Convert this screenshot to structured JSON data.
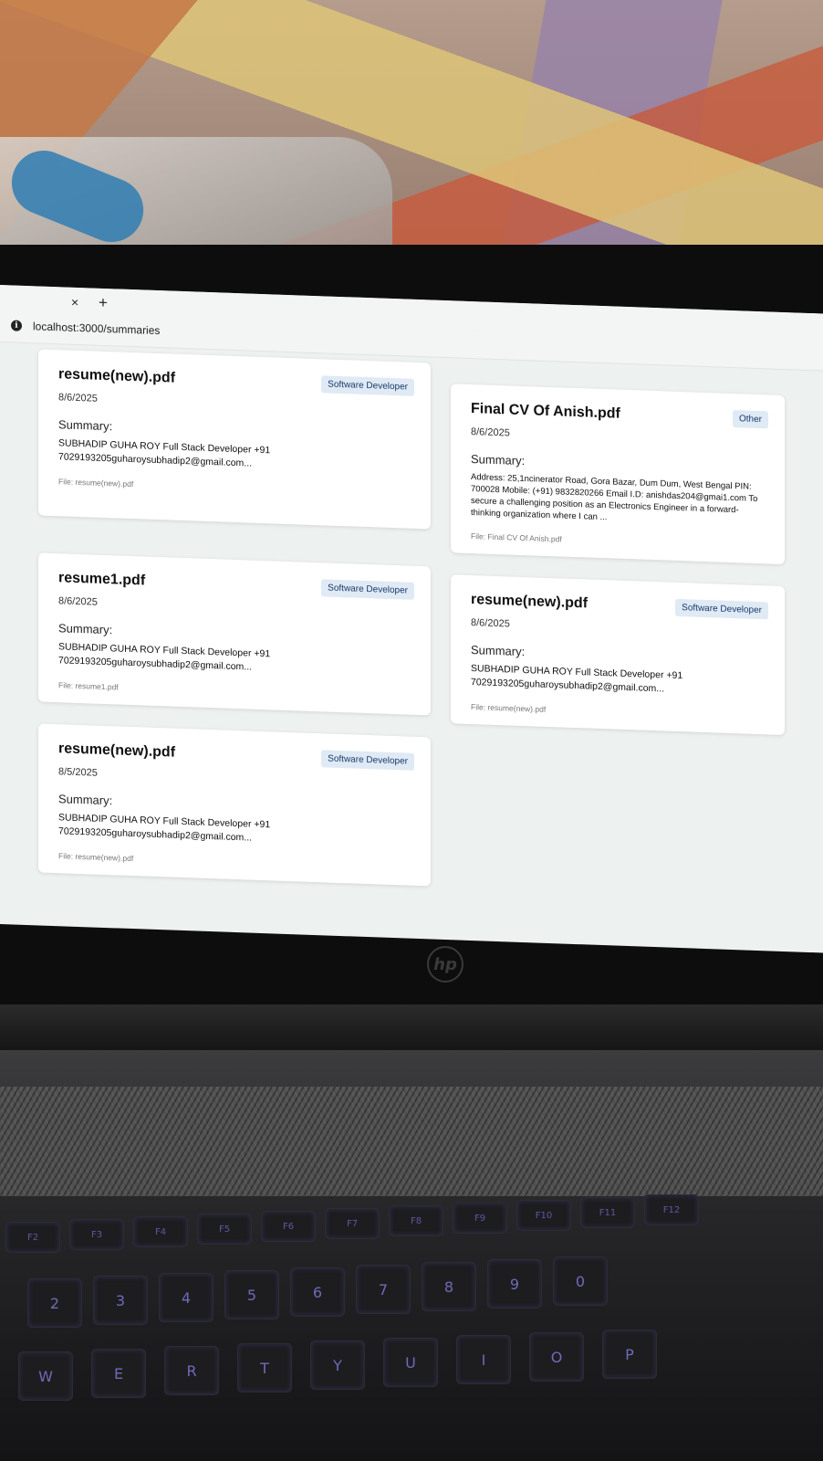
{
  "browser": {
    "url": "localhost:3000/summaries",
    "tab_close_icon": "×",
    "tab_new_icon": "+",
    "info_icon": "i"
  },
  "labels": {
    "summary": "Summary:",
    "file_prefix": "File: "
  },
  "cards": [
    {
      "title": "resume(new).pdf",
      "date": "8/6/2025",
      "badge": "Software Developer",
      "summary": "SUBHADIP GUHA ROY Full Stack Developer +91 7029193205guharoysubhadip2@gmail.com...",
      "file": "File: resume(new).pdf"
    },
    {
      "title": "Final CV Of Anish.pdf",
      "date": "8/6/2025",
      "badge": "Other",
      "summary": "Address: 25,1ncinerator Road, Gora Bazar, Dum Dum, West Bengal PIN: 700028 Mobile: (+91) 9832820266 Email I.D: anishdas204@gmai1.com To secure a challenging position as an Electronics Engineer in a forward-thinking organization where I can ...",
      "file": "File: Final CV Of Anish.pdf"
    },
    {
      "title": "resume1.pdf",
      "date": "8/6/2025",
      "badge": "Software Developer",
      "summary": "SUBHADIP GUHA ROY Full Stack Developer +91 7029193205guharoysubhadip2@gmail.com...",
      "file": "File: resume1.pdf"
    },
    {
      "title": "resume(new).pdf",
      "date": "8/6/2025",
      "badge": "Software Developer",
      "summary": "SUBHADIP GUHA ROY Full Stack Developer +91 7029193205guharoysubhadip2@gmail.com...",
      "file": "File: resume(new).pdf"
    },
    {
      "title": "resume(new).pdf",
      "date": "8/5/2025",
      "badge": "Software Developer",
      "summary": "SUBHADIP GUHA ROY Full Stack Developer +91 7029193205guharoysubhadip2@gmail.com...",
      "file": "File: resume(new).pdf"
    }
  ],
  "laptop": {
    "logo": "hp",
    "fn_keys": [
      "F2",
      "F3",
      "F4",
      "F5",
      "F6",
      "F7",
      "F8",
      "F9",
      "F10",
      "F11",
      "F12"
    ],
    "number_keys": [
      "2",
      "3",
      "4",
      "5",
      "6",
      "7",
      "8",
      "9",
      "0"
    ],
    "letter_keys": [
      "W",
      "E",
      "R",
      "T",
      "Y",
      "U",
      "I",
      "O",
      "P"
    ]
  },
  "colors": {
    "screen_bg": "#edf1ef",
    "card_bg": "#ffffff",
    "badge_bg": "#dfeaf5",
    "badge_text": "#1b3b6b",
    "keyboard_glow": "#6f6ab8"
  }
}
